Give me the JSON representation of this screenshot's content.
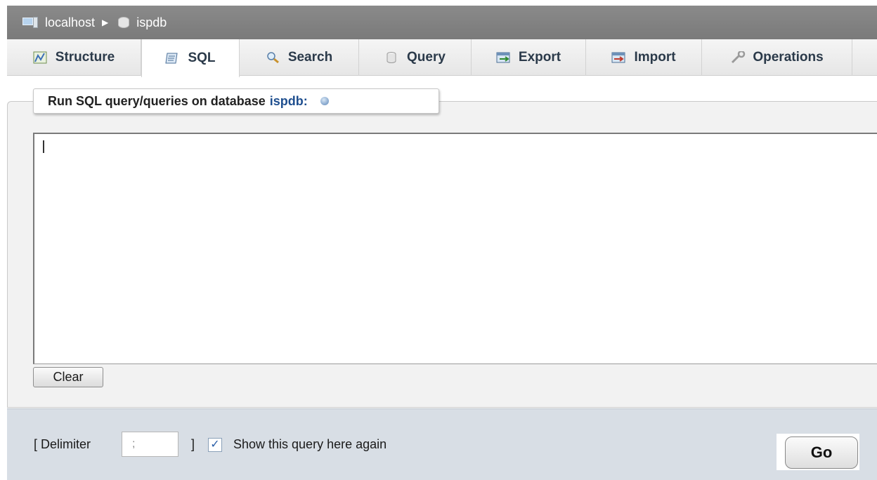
{
  "breadcrumb": {
    "server": "localhost",
    "separator": "▶",
    "database": "ispdb"
  },
  "tabs": [
    {
      "label": "Structure",
      "icon": "structure-icon",
      "active": false
    },
    {
      "label": "SQL",
      "icon": "sql-icon",
      "active": true
    },
    {
      "label": "Search",
      "icon": "search-icon",
      "active": false
    },
    {
      "label": "Query",
      "icon": "query-icon",
      "active": false
    },
    {
      "label": "Export",
      "icon": "export-icon",
      "active": false
    },
    {
      "label": "Import",
      "icon": "import-icon",
      "active": false
    },
    {
      "label": "Operations",
      "icon": "operations-icon",
      "active": false
    }
  ],
  "sql_panel": {
    "legend_prefix": "Run SQL query/queries on database",
    "legend_db": "ispdb:",
    "help_icon": "help-icon",
    "query_value": "",
    "clear_label": "Clear"
  },
  "footer": {
    "delimiter_label": "[ Delimiter",
    "delimiter_value": ";",
    "delimiter_close": "]",
    "show_again_checked": true,
    "show_again_label": "Show this query here again",
    "go_label": "Go"
  },
  "colors": {
    "breadcrumb_bg": "#808080",
    "footer_bg": "#d8dee5",
    "db_name": "#1f4f8f"
  }
}
